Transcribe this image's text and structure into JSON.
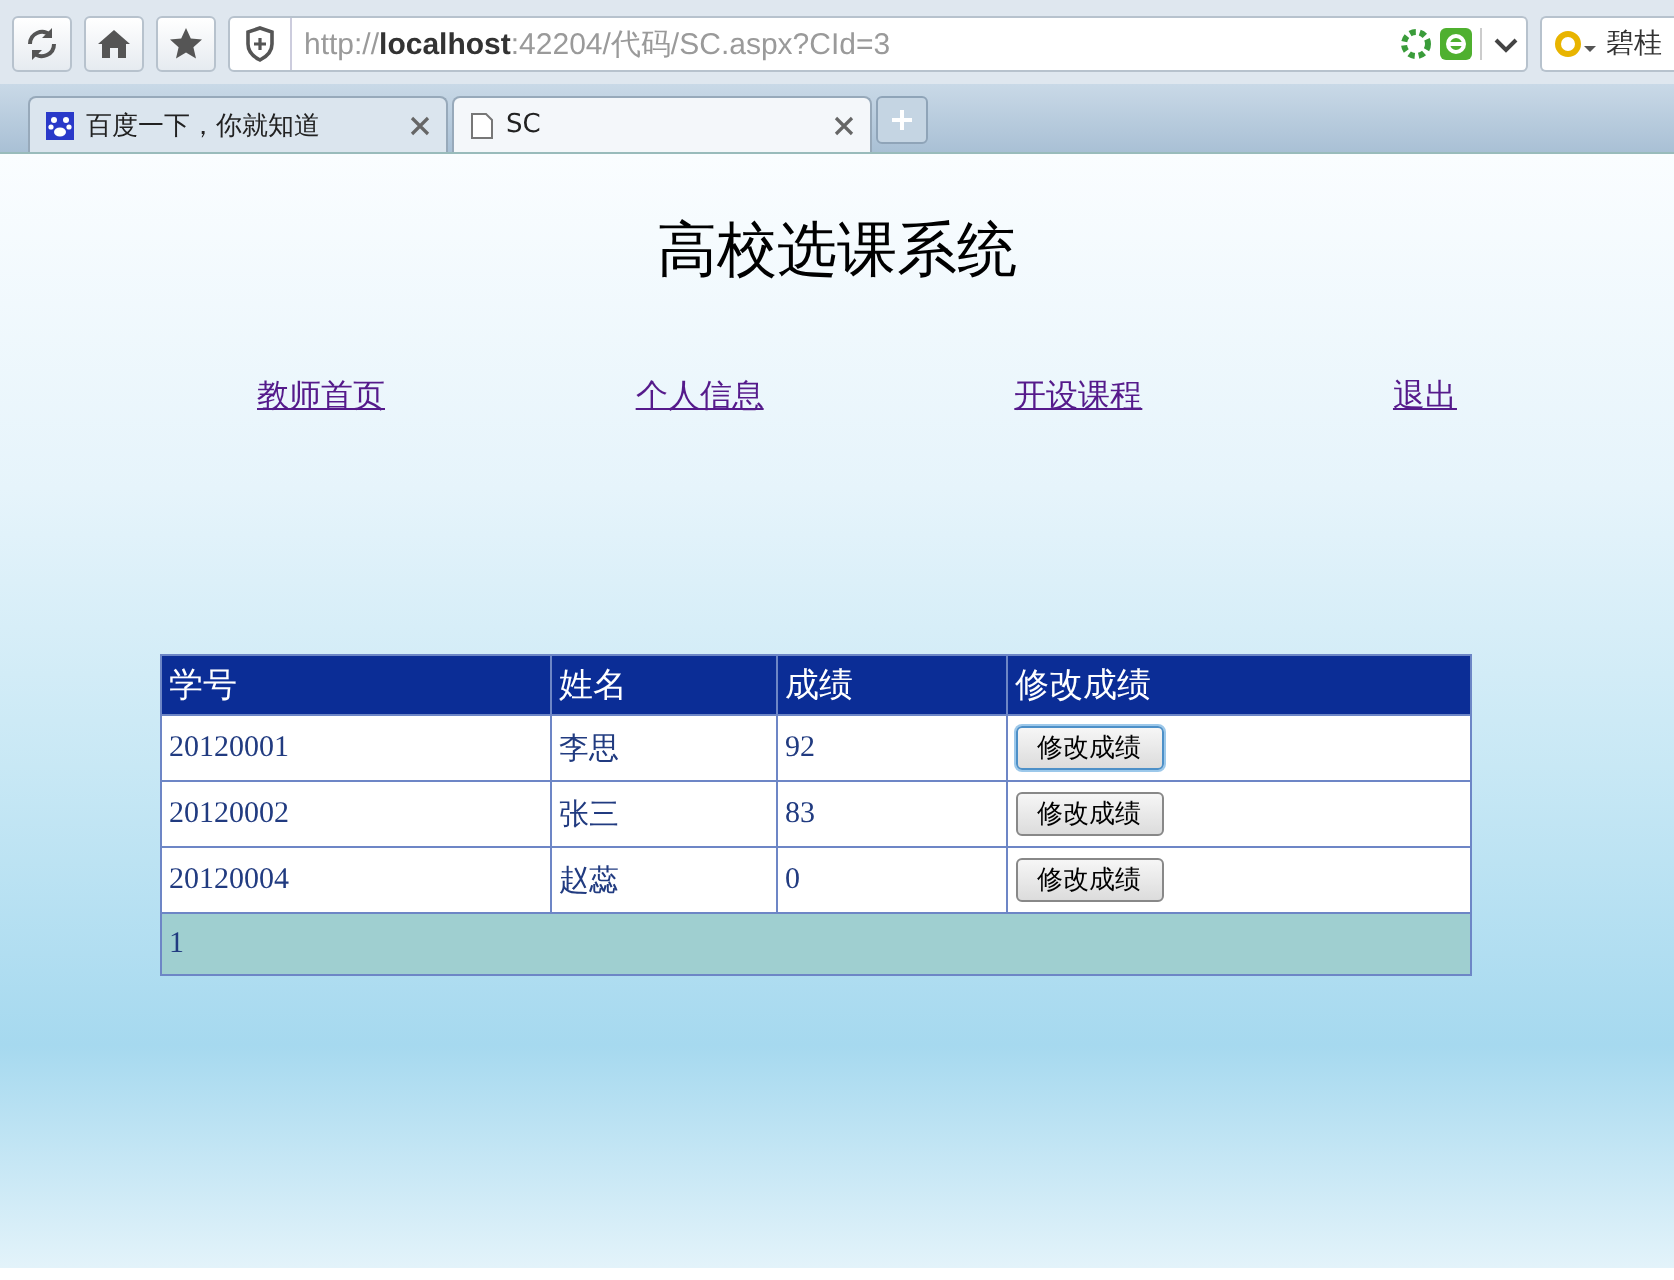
{
  "browser": {
    "address": "http://**localhost**:42204/代码/SC.aspx?CId=3",
    "search_text": "碧桂",
    "tabs": [
      {
        "label": "百度一下，你就知道",
        "selected": false,
        "kind": "paw"
      },
      {
        "label": "SC",
        "selected": true,
        "kind": "page"
      }
    ]
  },
  "page": {
    "title": "高校选课系统",
    "nav": [
      "教师首页",
      "个人信息",
      "开设课程",
      "退出"
    ],
    "table": {
      "columns": [
        "学号",
        "姓名",
        "成绩",
        "修改成绩"
      ],
      "rows": [
        {
          "id": "20120001",
          "name": "李思",
          "score": "92",
          "button": "修改成绩",
          "focused": true
        },
        {
          "id": "20120002",
          "name": "张三",
          "score": "83",
          "button": "修改成绩",
          "focused": false
        },
        {
          "id": "20120004",
          "name": "赵蕊",
          "score": "0",
          "button": "修改成绩",
          "focused": false
        }
      ],
      "pager": "1"
    }
  }
}
